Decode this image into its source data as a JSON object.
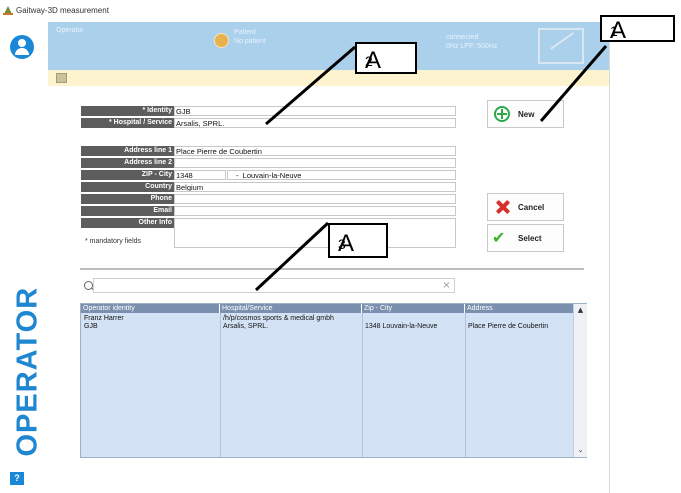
{
  "window": {
    "title": "Gaitway-3D measurement"
  },
  "sidebar": {
    "section_label": "OPERATOR",
    "help_label": "?"
  },
  "header": {
    "operator_label": "Operator",
    "patient_label": "Patient",
    "patient_value": "No patient",
    "connection_label": "connected",
    "connection_detail": "0Hz  LPF: 500Hz"
  },
  "form": {
    "identity_label": "* Identity",
    "identity_value": "GJB",
    "hospital_label": "* Hospital / Service",
    "hospital_value": "Arsalis, SPRL.",
    "address1_label": "Address line 1",
    "address1_value": "Place Pierre de Coubertin",
    "address2_label": "Address line 2",
    "address2_value": "",
    "zip_city_label": "ZIP  -  City",
    "zip_value": "1348",
    "zip_sep": "-",
    "city_value": "Louvain-la-Neuve",
    "country_label": "Country",
    "country_value": "Belgium",
    "phone_label": "Phone",
    "phone_value": "",
    "email_label": "Email",
    "email_value": "",
    "other_label": "Other Info",
    "mandatory_note": "* mandatory fields"
  },
  "buttons": {
    "new": "New",
    "cancel": "Cancel",
    "select": "Select"
  },
  "search": {
    "placeholder": "",
    "clear": "×"
  },
  "table": {
    "headers": [
      "Operator identity",
      "Hospital/Service",
      "Zip - City",
      "Address"
    ],
    "rows": [
      {
        "identity": "Franz Harrer",
        "hospital": "/h/p/cosmos sports & medical gmbh",
        "zip_city": "",
        "address": ""
      },
      {
        "identity": "GJB",
        "hospital": "Arsalis, SPRL.",
        "zip_city": "1348 Louvain-la-Neuve",
        "address": "Place Pierre de Coubertin"
      }
    ]
  },
  "annotations": {
    "a1": {
      "letter": "A",
      "index": "1"
    },
    "a2": {
      "letter": "A",
      "index": "2"
    },
    "a3": {
      "letter": "A",
      "index": "3"
    }
  },
  "colors": {
    "accent": "#1a88d6",
    "header_bg": "#aad0ec",
    "label_bg": "#5d5d5d",
    "table_bg": "#d4e2f5",
    "new_green": "#2fa84a",
    "cancel_red": "#d5302c"
  }
}
